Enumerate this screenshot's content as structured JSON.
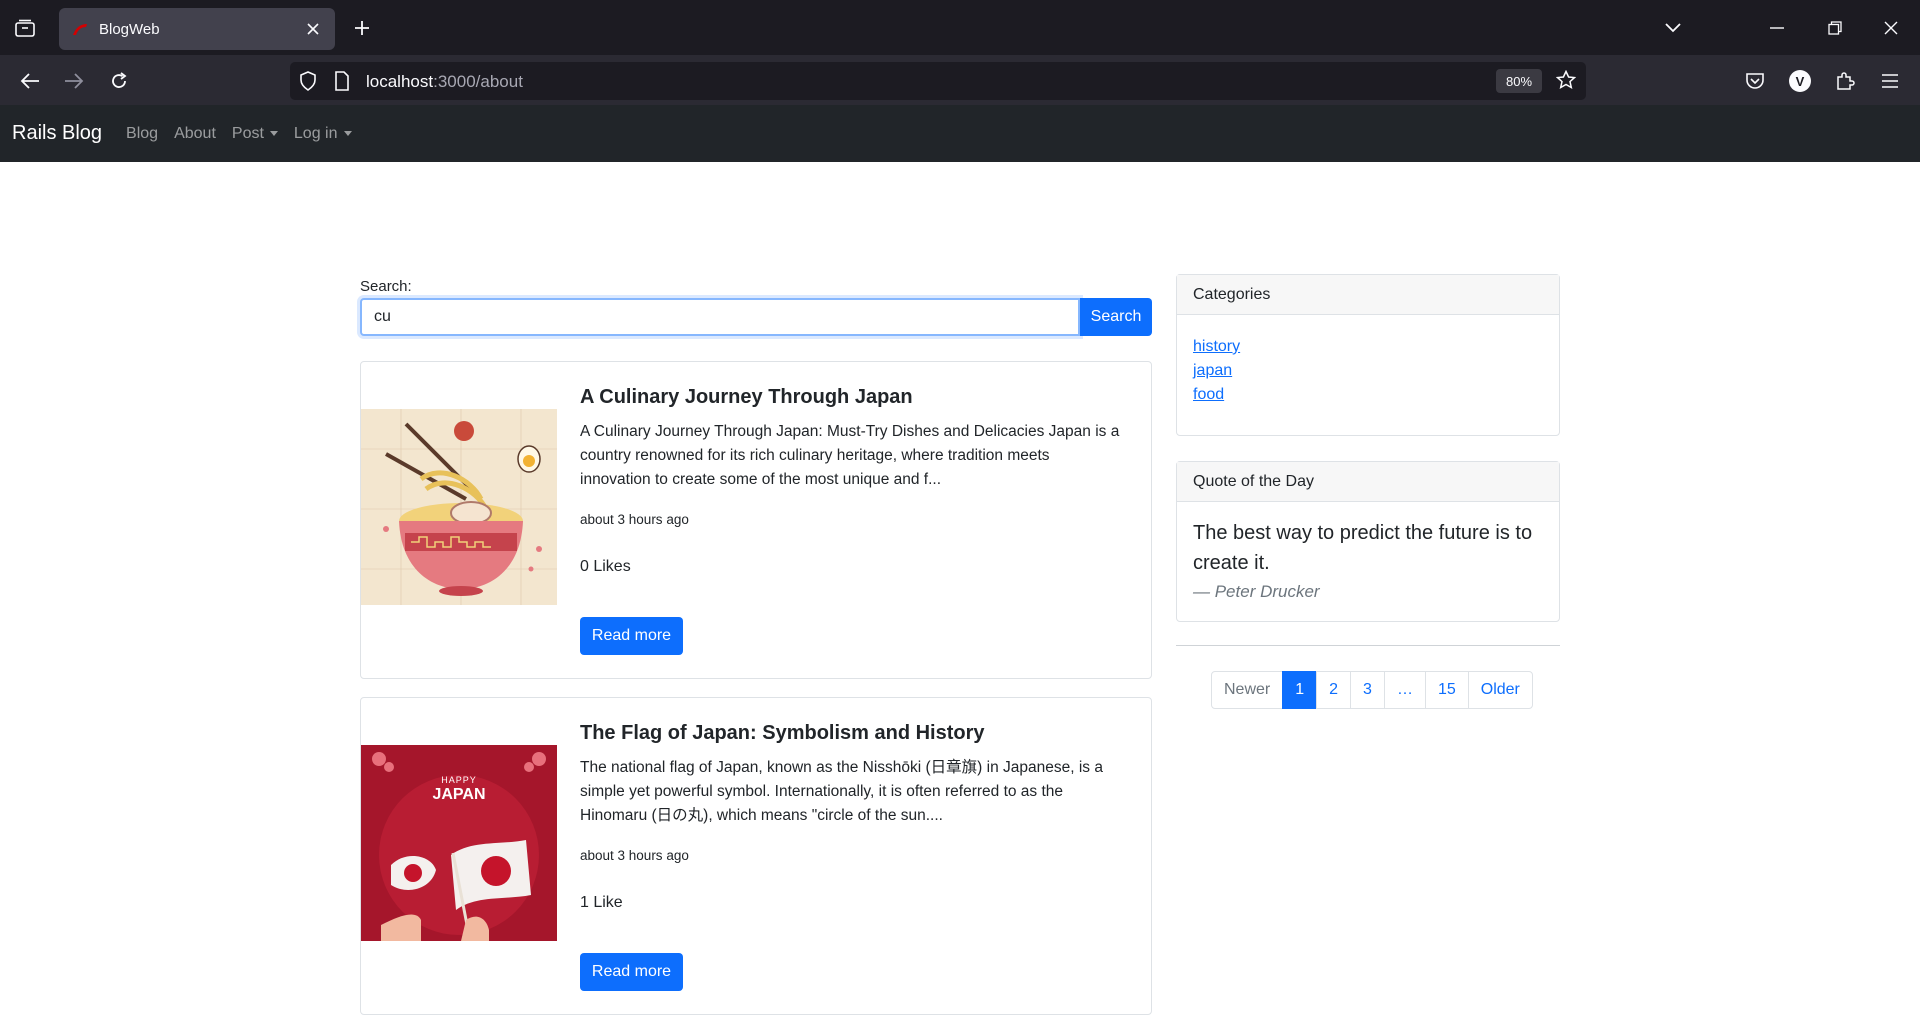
{
  "browser": {
    "tab_title": "BlogWeb",
    "url_host": "localhost",
    "url_rest": ":3000/about",
    "zoom": "80%",
    "profile_initial": "V"
  },
  "site": {
    "brand": "Rails Blog",
    "nav": {
      "blog": "Blog",
      "about": "About",
      "post": "Post",
      "login": "Log in"
    }
  },
  "search": {
    "label": "Search:",
    "value": "cu",
    "button": "Search"
  },
  "posts": [
    {
      "title": "A Culinary Journey Through Japan",
      "excerpt": "A Culinary Journey Through Japan: Must-Try Dishes and Delicacies Japan is a country renowned for its rich culinary heritage, where tradition meets innovation to create some of the most unique and f...",
      "time": "about 3 hours ago",
      "likes": "0 Likes",
      "read_more": "Read more"
    },
    {
      "title": "The Flag of Japan: Symbolism and History",
      "excerpt": "The national flag of Japan, known as the Nisshōki (日章旗) in Japanese, is a simple yet powerful symbol. Internationally, it is often referred to as the Hinomaru (日の丸), which means \"circle of the sun....",
      "time": "about 3 hours ago",
      "likes": "1 Like",
      "read_more": "Read more",
      "image_text_top": "HAPPY",
      "image_text_main": "JAPAN"
    }
  ],
  "sidebar": {
    "categories_title": "Categories",
    "categories": [
      "history",
      "japan",
      "food"
    ],
    "quote_title": "Quote of the Day",
    "quote_text": "The best way to predict the future is to create it.",
    "quote_author": "— Peter Drucker"
  },
  "pagination": {
    "newer": "Newer",
    "pages": [
      "1",
      "2",
      "3",
      "…",
      "15"
    ],
    "older": "Older"
  },
  "colors": {
    "primary": "#0d6efd",
    "navbar": "#212529",
    "chrome_dark": "#1c1b22"
  }
}
